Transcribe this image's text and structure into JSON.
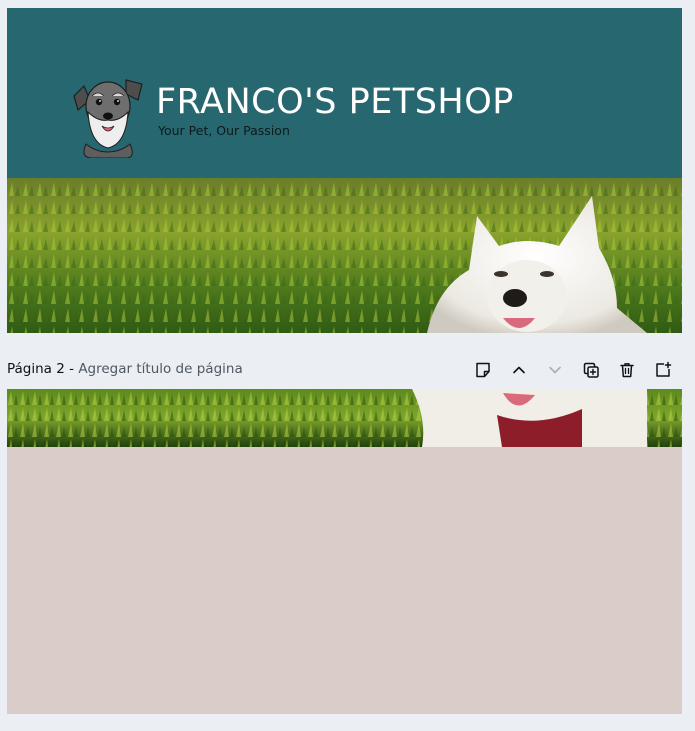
{
  "page1": {
    "brand_title": "FRANCO'S PETSHOP",
    "tagline": "Your Pet, Our Passion",
    "header_color": "#276770"
  },
  "page_bar": {
    "page_label": "Página 2",
    "separator": " - ",
    "title_placeholder": "Agregar título de página",
    "tools": [
      "notes-icon",
      "chevron-up-icon",
      "chevron-down-icon",
      "duplicate-page-icon",
      "trash-icon",
      "add-page-icon"
    ]
  },
  "page2": {
    "background_color": "#d9ccc9"
  }
}
